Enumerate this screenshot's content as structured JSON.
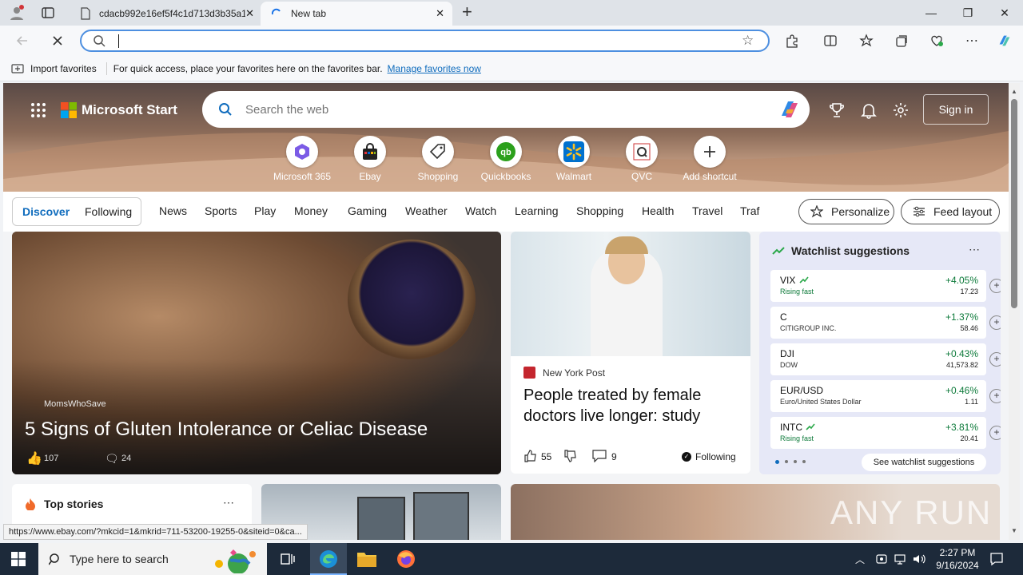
{
  "browser": {
    "tabs": [
      {
        "title": "cdacb992e16ef5f4c1d713d3b35a1"
      },
      {
        "title": "New tab"
      }
    ],
    "address": {
      "value": "",
      "placeholder": ""
    },
    "favorites_bar": {
      "import_label": "Import favorites",
      "message": "For quick access, place your favorites here on the favorites bar.",
      "manage_link": "Manage favorites now"
    },
    "status_url": "https://www.ebay.com/?mkcid=1&mkrid=711-53200-19255-0&siteid=0&ca..."
  },
  "msn": {
    "brand": "Microsoft Start",
    "search_placeholder": "Search the web",
    "sign_in": "Sign in",
    "shortcuts": [
      {
        "label": "Microsoft 365",
        "icon": "microsoft-365-icon"
      },
      {
        "label": "Ebay",
        "icon": "ebay-icon"
      },
      {
        "label": "Shopping",
        "icon": "shopping-tag-icon"
      },
      {
        "label": "Quickbooks",
        "icon": "quickbooks-icon"
      },
      {
        "label": "Walmart",
        "icon": "walmart-icon"
      },
      {
        "label": "QVC",
        "icon": "qvc-icon"
      },
      {
        "label": "Add shortcut",
        "icon": "plus-icon"
      }
    ],
    "nav": {
      "discover": "Discover",
      "following": "Following",
      "items": [
        "News",
        "Sports",
        "Play",
        "Money",
        "Gaming",
        "Weather",
        "Watch",
        "Learning",
        "Shopping",
        "Health",
        "Travel",
        "Traf"
      ],
      "personalize": "Personalize",
      "feed_layout": "Feed layout"
    },
    "hero_article": {
      "source": "MomsWhoSave",
      "title": "5 Signs of Gluten Intolerance or Celiac Disease",
      "likes": "107",
      "comments": "24"
    },
    "article2": {
      "source": "New York Post",
      "title": "People treated by female doctors live longer: study",
      "likes": "55",
      "comments": "9",
      "following": "Following"
    },
    "watchlist": {
      "title": "Watchlist suggestions",
      "rows": [
        {
          "symbol": "VIX",
          "sub": "Rising fast",
          "pct": "+4.05%",
          "value": "17.23",
          "rising": true
        },
        {
          "symbol": "C",
          "sub": "CITIGROUP INC.",
          "pct": "+1.37%",
          "value": "58.46",
          "rising": false
        },
        {
          "symbol": "DJI",
          "sub": "DOW",
          "pct": "+0.43%",
          "value": "41,573.82",
          "rising": false
        },
        {
          "symbol": "EUR/USD",
          "sub": "Euro/United States Dollar",
          "pct": "+0.46%",
          "value": "1.11",
          "rising": false
        },
        {
          "symbol": "INTC",
          "sub": "Rising fast",
          "pct": "+3.81%",
          "value": "20.41",
          "rising": true
        }
      ],
      "see_more": "See watchlist suggestions"
    },
    "top_stories": {
      "title": "Top stories"
    }
  },
  "taskbar": {
    "search_placeholder": "Type here to search",
    "time": "2:27 PM",
    "date": "9/16/2024"
  },
  "watermark": "ANY RUN",
  "colors": {
    "accent": "#0f6cbd",
    "positive": "#0d7a3a",
    "taskbar": "#1d2a3a"
  }
}
